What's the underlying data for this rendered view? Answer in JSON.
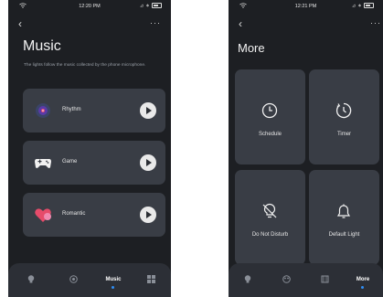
{
  "music_screen": {
    "status_time": "12:20 PM",
    "back": "‹",
    "more_menu": "···",
    "title": "Music",
    "subtitle": "The lights follow the music collected by the phone microphone.",
    "modes": [
      {
        "label": "Rhythm",
        "icon": "vinyl-record-icon"
      },
      {
        "label": "Game",
        "icon": "gamepad-icon"
      },
      {
        "label": "Romantic",
        "icon": "heart-icon"
      }
    ],
    "tabs": [
      {
        "label": "",
        "icon": "bulb-icon"
      },
      {
        "label": "",
        "icon": "palette-icon"
      },
      {
        "label": "Music",
        "icon": "music-icon"
      },
      {
        "label": "",
        "icon": "grid-icon"
      }
    ],
    "active_tab": "Music"
  },
  "more_screen": {
    "status_time": "12:21 PM",
    "back": "‹",
    "more_menu": "···",
    "title": "More",
    "tiles": [
      {
        "label": "Schedule",
        "icon": "clock-icon"
      },
      {
        "label": "Timer",
        "icon": "timer-icon"
      },
      {
        "label": "Do Not Disturb",
        "icon": "bulb-off-icon"
      },
      {
        "label": "Default Light",
        "icon": "bell-icon"
      }
    ],
    "tabs": [
      {
        "label": "",
        "icon": "bulb-icon"
      },
      {
        "label": "",
        "icon": "palette-icon"
      },
      {
        "label": "",
        "icon": "film-icon"
      },
      {
        "label": "More",
        "icon": "more-icon"
      }
    ],
    "active_tab": "More"
  }
}
